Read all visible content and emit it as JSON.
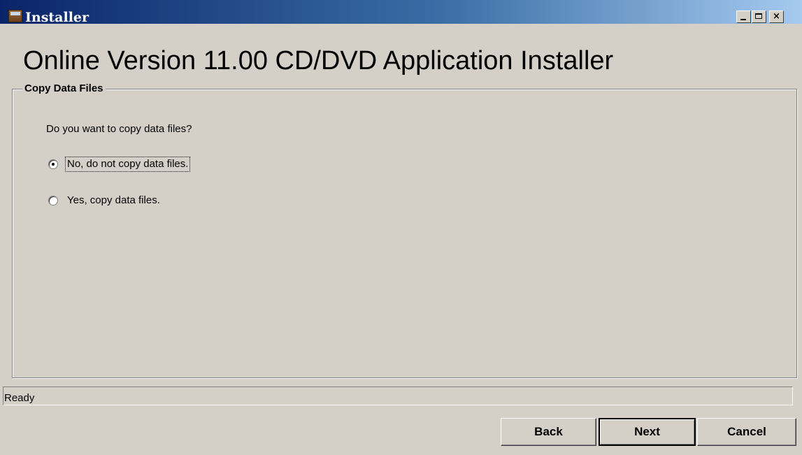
{
  "window": {
    "title": "Installer",
    "app_icon": "installer-box-icon",
    "controls": {
      "minimize": "minimize-icon",
      "maximize": "maximize-icon",
      "close_label": "×"
    }
  },
  "main": {
    "heading": "Online Version 11.00 CD/DVD Application Installer",
    "group": {
      "title": "Copy Data Files",
      "question": "Do you want to copy data files?",
      "options": [
        {
          "label": "No, do not copy data files.",
          "checked": true
        },
        {
          "label": "Yes, copy data files.",
          "checked": false
        }
      ]
    }
  },
  "status": {
    "text": "Ready"
  },
  "buttons": {
    "back": "Back",
    "next": "Next",
    "cancel": "Cancel"
  },
  "colors": {
    "title_gradient_start": "#0a246a",
    "title_gradient_end": "#a6caf0",
    "window_background": "#d4d0c8"
  }
}
